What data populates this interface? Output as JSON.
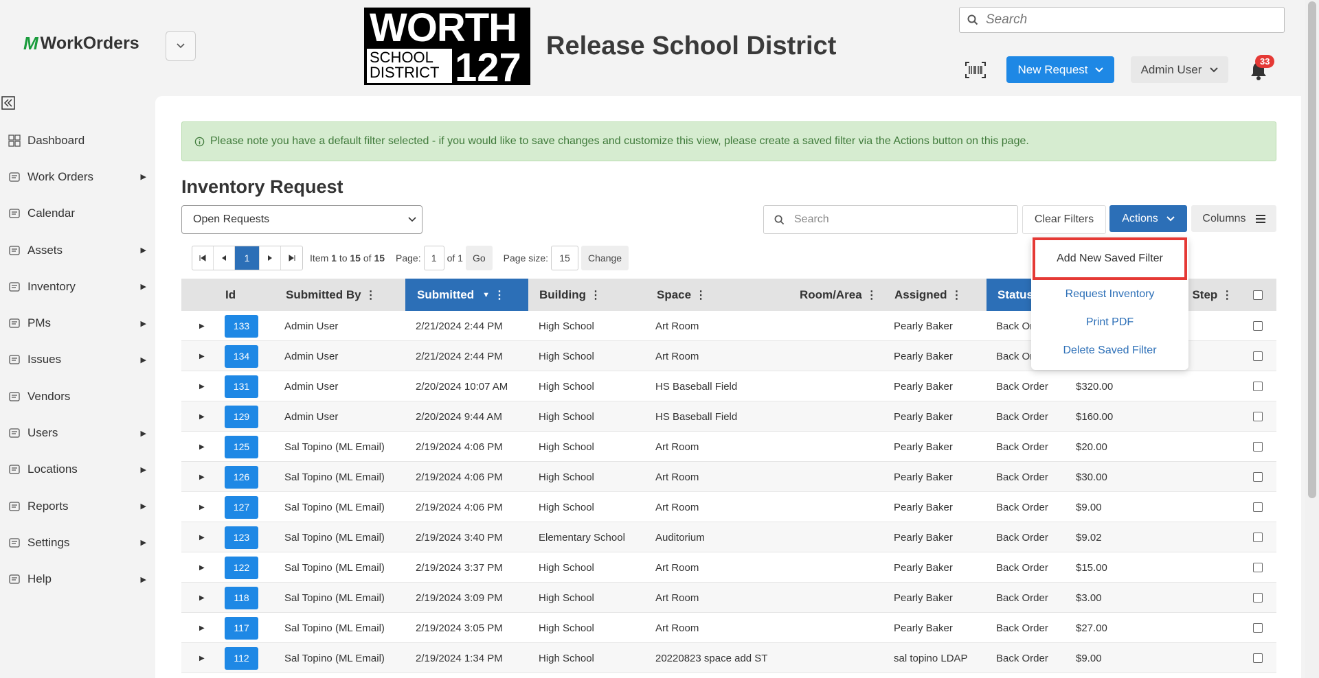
{
  "app": {
    "name": "WorkOrders"
  },
  "district": {
    "logo_top": "WORTH",
    "logo_sub": "SCHOOL DISTRICT",
    "logo_num": "127",
    "name": "Release School District"
  },
  "header": {
    "search_placeholder": "Search",
    "new_request": "New Request",
    "user": "Admin User",
    "notifications": "33"
  },
  "sidebar": {
    "items": [
      {
        "label": "Dashboard",
        "arrow": false,
        "icon": "dashboard-icon"
      },
      {
        "label": "Work Orders",
        "arrow": true,
        "icon": "work-orders-icon"
      },
      {
        "label": "Calendar",
        "arrow": false,
        "icon": "calendar-icon"
      },
      {
        "label": "Assets",
        "arrow": true,
        "icon": "assets-icon"
      },
      {
        "label": "Inventory",
        "arrow": true,
        "icon": "inventory-icon"
      },
      {
        "label": "PMs",
        "arrow": true,
        "icon": "pms-icon"
      },
      {
        "label": "Issues",
        "arrow": true,
        "icon": "issues-icon"
      },
      {
        "label": "Vendors",
        "arrow": false,
        "icon": "vendors-icon"
      },
      {
        "label": "Users",
        "arrow": true,
        "icon": "users-icon"
      },
      {
        "label": "Locations",
        "arrow": true,
        "icon": "locations-icon"
      },
      {
        "label": "Reports",
        "arrow": true,
        "icon": "reports-icon"
      },
      {
        "label": "Settings",
        "arrow": true,
        "icon": "settings-icon"
      },
      {
        "label": "Help",
        "arrow": true,
        "icon": "help-icon"
      }
    ]
  },
  "notice": "Please note you have a default filter selected - if you would like to save changes and customize this view, please create a saved filter via the Actions button on this page.",
  "page_title": "Inventory Request",
  "filter_select": "Open Requests",
  "grid_search_placeholder": "Search",
  "buttons": {
    "clear_filters": "Clear Filters",
    "actions": "Actions",
    "columns": "Columns"
  },
  "pager": {
    "current": "1",
    "item_prefix": "Item",
    "item_from": "1",
    "item_to_word": "to",
    "item_to": "15",
    "item_of_word": "of",
    "item_total": "15",
    "page_label": "Page:",
    "page_value": "1",
    "page_of": "of 1",
    "go": "Go",
    "size_label": "Page size:",
    "size_value": "15",
    "change": "Change"
  },
  "columns": {
    "id": "Id",
    "submitted_by": "Submitted By",
    "submitted": "Submitted",
    "building": "Building",
    "space": "Space",
    "room": "Room/Area",
    "assigned": "Assigned",
    "status": "Status",
    "step": "l Step"
  },
  "rows": [
    {
      "id": "133",
      "by": "Admin User",
      "date": "2/21/2024 2:44 PM",
      "building": "High School",
      "space": "Art Room",
      "assigned": "Pearly Baker",
      "status": "Back Or",
      "amount": ""
    },
    {
      "id": "134",
      "by": "Admin User",
      "date": "2/21/2024 2:44 PM",
      "building": "High School",
      "space": "Art Room",
      "assigned": "Pearly Baker",
      "status": "Back Or",
      "amount": ""
    },
    {
      "id": "131",
      "by": "Admin User",
      "date": "2/20/2024 10:07 AM",
      "building": "High School",
      "space": "HS Baseball Field",
      "assigned": "Pearly Baker",
      "status": "Back Order",
      "amount": "$320.00"
    },
    {
      "id": "129",
      "by": "Admin User",
      "date": "2/20/2024 9:44 AM",
      "building": "High School",
      "space": "HS Baseball Field",
      "assigned": "Pearly Baker",
      "status": "Back Order",
      "amount": "$160.00"
    },
    {
      "id": "125",
      "by": "Sal Topino (ML Email)",
      "date": "2/19/2024 4:06 PM",
      "building": "High School",
      "space": "Art Room",
      "assigned": "Pearly Baker",
      "status": "Back Order",
      "amount": "$20.00"
    },
    {
      "id": "126",
      "by": "Sal Topino (ML Email)",
      "date": "2/19/2024 4:06 PM",
      "building": "High School",
      "space": "Art Room",
      "assigned": "Pearly Baker",
      "status": "Back Order",
      "amount": "$30.00"
    },
    {
      "id": "127",
      "by": "Sal Topino (ML Email)",
      "date": "2/19/2024 4:06 PM",
      "building": "High School",
      "space": "Art Room",
      "assigned": "Pearly Baker",
      "status": "Back Order",
      "amount": "$9.00"
    },
    {
      "id": "123",
      "by": "Sal Topino (ML Email)",
      "date": "2/19/2024 3:40 PM",
      "building": "Elementary School",
      "space": "Auditorium",
      "assigned": "Pearly Baker",
      "status": "Back Order",
      "amount": "$9.02"
    },
    {
      "id": "122",
      "by": "Sal Topino (ML Email)",
      "date": "2/19/2024 3:37 PM",
      "building": "High School",
      "space": "Art Room",
      "assigned": "Pearly Baker",
      "status": "Back Order",
      "amount": "$15.00"
    },
    {
      "id": "118",
      "by": "Sal Topino (ML Email)",
      "date": "2/19/2024 3:09 PM",
      "building": "High School",
      "space": "Art Room",
      "assigned": "Pearly Baker",
      "status": "Back Order",
      "amount": "$3.00"
    },
    {
      "id": "117",
      "by": "Sal Topino (ML Email)",
      "date": "2/19/2024 3:05 PM",
      "building": "High School",
      "space": "Art Room",
      "assigned": "Pearly Baker",
      "status": "Back Order",
      "amount": "$27.00"
    },
    {
      "id": "112",
      "by": "Sal Topino (ML Email)",
      "date": "2/19/2024 1:34 PM",
      "building": "High School",
      "space": "20220823 space add ST",
      "assigned": "sal topino LDAP",
      "status": "Back Order",
      "amount": "$9.00"
    }
  ],
  "actions_menu": [
    "Add New Saved Filter",
    "Request Inventory",
    "Print PDF",
    "Delete Saved Filter"
  ],
  "colors": {
    "primary": "#1e88e5",
    "actions": "#2c6fb7",
    "notice_bg": "#d6ecd0",
    "highlight": "#e53935"
  }
}
